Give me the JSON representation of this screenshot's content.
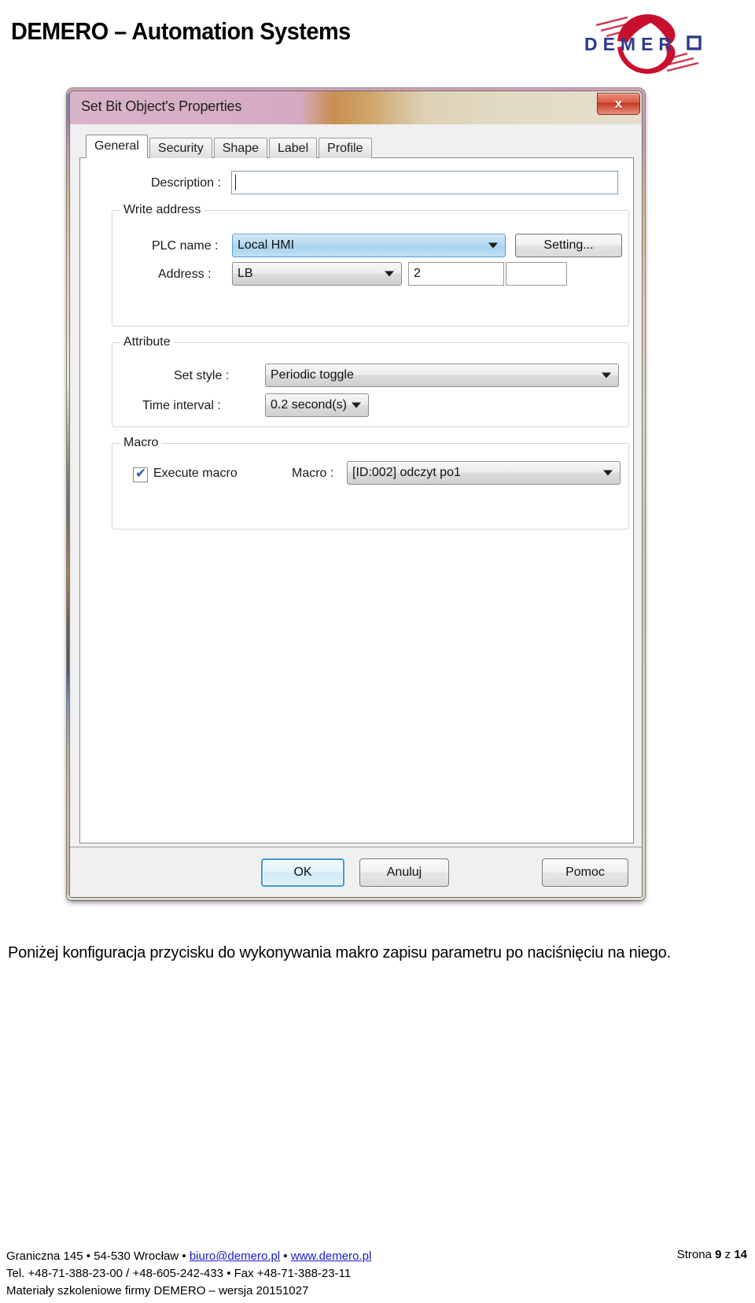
{
  "header": {
    "brand_title": "DEMERO – Automation Systems",
    "logo_text": "D E M E R O",
    "logo_accent": "#c8102e",
    "logo_wordmark_color": "#2d3a8c"
  },
  "dialog": {
    "title": "Set Bit Object's Properties",
    "close_icon": "close-icon",
    "close_label": "x",
    "tabs": [
      {
        "label": "General",
        "active": true
      },
      {
        "label": "Security",
        "active": false
      },
      {
        "label": "Shape",
        "active": false
      },
      {
        "label": "Label",
        "active": false
      },
      {
        "label": "Profile",
        "active": false
      }
    ],
    "description": {
      "label": "Description :",
      "value": "",
      "placeholder": ""
    },
    "write_address": {
      "group_title": "Write address",
      "plc_name_label": "PLC name :",
      "plc_name_value": "Local HMI",
      "setting_button": "Setting...",
      "address_label": "Address :",
      "address_type_value": "LB",
      "address_value": "2",
      "address_extra_value": ""
    },
    "attribute": {
      "group_title": "Attribute",
      "set_style_label": "Set style :",
      "set_style_value": "Periodic toggle",
      "time_interval_label": "Time interval :",
      "time_interval_value": "0.2  second(s)"
    },
    "macro": {
      "group_title": "Macro",
      "execute_macro_label": "Execute macro",
      "execute_macro_checked": true,
      "check_glyph": "✔",
      "macro_label": "Macro :",
      "macro_value": "[ID:002] odczyt po1"
    },
    "buttons": {
      "ok": "OK",
      "cancel": "Anuluj",
      "help": "Pomoc"
    },
    "accent_focus_color": "#3c9ad6",
    "titlebar_gradient_start": "#d9b4c9",
    "titlebar_gradient_end": "#e4decb"
  },
  "body_text": "Poniżej konfiguracja przycisku do wykonywania makro zapisu parametru po naciśnięciu na niego.",
  "footer": {
    "line1_pre": "Graniczna 145 • 54-530 Wrocław • ",
    "line1_email": "biuro@demero.pl",
    "line1_mid": " • ",
    "line1_web": "www.demero.pl",
    "line2": "Tel. +48-71-388-23-00 / +48-605-242-433 • Fax +48-71-388-23-11",
    "line3": "Materiały szkoleniowe firmy DEMERO – wersja 20151027",
    "page_pre": "Strona ",
    "page_number": "9",
    "page_mid": " z ",
    "page_total": "14",
    "link_color": "#1a1ad0"
  }
}
